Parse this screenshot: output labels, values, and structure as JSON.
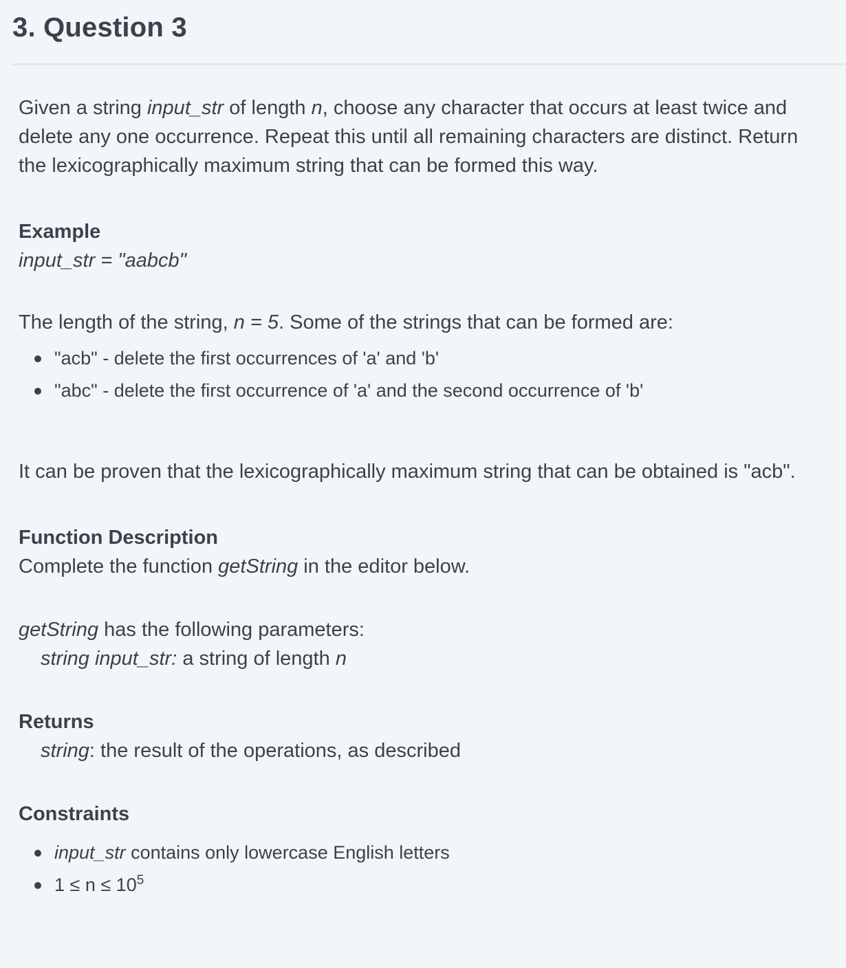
{
  "question": {
    "title": "3. Question 3"
  },
  "intro": {
    "p1": "Given a string ",
    "var1": "input_str",
    "p2": " of length ",
    "var2": "n",
    "p3": ", choose any character that occurs at least twice and delete any one occurrence.  Repeat this until all remaining characters are distinct.  Return the lexicographically maximum string that can be formed this way."
  },
  "example": {
    "heading": "Example",
    "input_line": "input_str = \"aabcb\"",
    "length_pre": "The length of the string, ",
    "length_var": "n = 5",
    "length_post": ". Some of the strings that can be formed are:",
    "bullets": [
      "\"acb\" - delete the first occurrences of 'a' and 'b'",
      "\"abc\" - delete the first occurrence of  'a' and the second occurrence of 'b'"
    ],
    "conclusion": "It can be proven that the lexicographically maximum string that can be obtained is \"acb\"."
  },
  "function_description": {
    "heading": "Function Description",
    "line_pre": "Complete the function ",
    "func_name": "getString",
    "line_post": " in the editor below.",
    "params_func": "getString",
    "params_text": " has the following parameters:",
    "param_name": "string input_str: ",
    "param_desc": " a string of length ",
    "param_var": "n"
  },
  "returns": {
    "heading": "Returns",
    "type": "string",
    "desc": ": the result of the operations, as described"
  },
  "constraints": {
    "heading": "Constraints",
    "c1_var": "input_str",
    "c1_text": " contains only lowercase English letters",
    "c2_text": "1 ≤ n ≤ 10",
    "c2_exp": "5"
  }
}
